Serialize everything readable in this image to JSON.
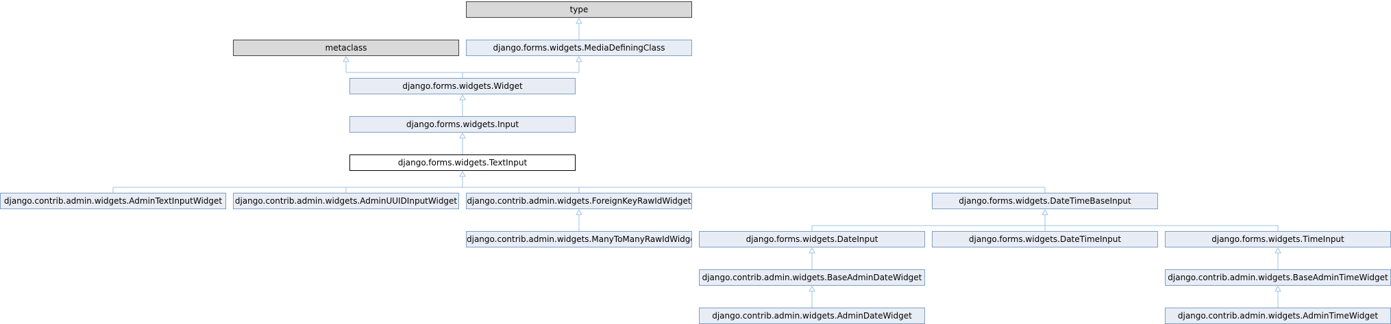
{
  "colors": {
    "edge": "#9ec1e6",
    "node_fill": "#e8edf5",
    "node_border": "#7f9ec1",
    "external_fill": "#d9d9d9",
    "current_border": "#000000"
  },
  "nodes": [
    {
      "id": "type",
      "label": "type",
      "style": "grey"
    },
    {
      "id": "metaclass",
      "label": "metaclass",
      "style": "grey"
    },
    {
      "id": "mdc",
      "label": "django.forms.widgets.MediaDefiningClass",
      "style": "normal"
    },
    {
      "id": "widget",
      "label": "django.forms.widgets.Widget",
      "style": "normal"
    },
    {
      "id": "input",
      "label": "django.forms.widgets.Input",
      "style": "normal"
    },
    {
      "id": "textinput",
      "label": "django.forms.widgets.TextInput",
      "style": "current"
    },
    {
      "id": "admintext",
      "label": "django.contrib.admin.widgets.AdminTextInputWidget",
      "style": "normal"
    },
    {
      "id": "adminuuid",
      "label": "django.contrib.admin.widgets.AdminUUIDInputWidget",
      "style": "normal"
    },
    {
      "id": "fkraw",
      "label": "django.contrib.admin.widgets.ForeignKeyRawIdWidget",
      "style": "normal"
    },
    {
      "id": "dtbase",
      "label": "django.forms.widgets.DateTimeBaseInput",
      "style": "normal"
    },
    {
      "id": "m2mraw",
      "label": "django.contrib.admin.widgets.ManyToManyRawIdWidget",
      "style": "normal"
    },
    {
      "id": "dateinput",
      "label": "django.forms.widgets.DateInput",
      "style": "normal"
    },
    {
      "id": "datetimeinput",
      "label": "django.forms.widgets.DateTimeInput",
      "style": "normal"
    },
    {
      "id": "timeinput",
      "label": "django.forms.widgets.TimeInput",
      "style": "normal"
    },
    {
      "id": "baseadmindate",
      "label": "django.contrib.admin.widgets.BaseAdminDateWidget",
      "style": "normal"
    },
    {
      "id": "baseadmintime",
      "label": "django.contrib.admin.widgets.BaseAdminTimeWidget",
      "style": "normal"
    },
    {
      "id": "admindate",
      "label": "django.contrib.admin.widgets.AdminDateWidget",
      "style": "normal"
    },
    {
      "id": "admintime",
      "label": "django.contrib.admin.widgets.AdminTimeWidget",
      "style": "normal"
    }
  ],
  "edges": [
    {
      "from": "mdc",
      "to": "type"
    },
    {
      "from": "widget",
      "to": "metaclass"
    },
    {
      "from": "widget",
      "to": "mdc"
    },
    {
      "from": "input",
      "to": "widget"
    },
    {
      "from": "textinput",
      "to": "input"
    },
    {
      "from": "admintext",
      "to": "textinput"
    },
    {
      "from": "adminuuid",
      "to": "textinput"
    },
    {
      "from": "fkraw",
      "to": "textinput"
    },
    {
      "from": "dtbase",
      "to": "textinput"
    },
    {
      "from": "m2mraw",
      "to": "fkraw"
    },
    {
      "from": "dateinput",
      "to": "dtbase"
    },
    {
      "from": "datetimeinput",
      "to": "dtbase"
    },
    {
      "from": "timeinput",
      "to": "dtbase"
    },
    {
      "from": "baseadmindate",
      "to": "dateinput"
    },
    {
      "from": "admindate",
      "to": "baseadmindate"
    },
    {
      "from": "baseadmintime",
      "to": "timeinput"
    },
    {
      "from": "admintime",
      "to": "baseadmintime"
    }
  ]
}
